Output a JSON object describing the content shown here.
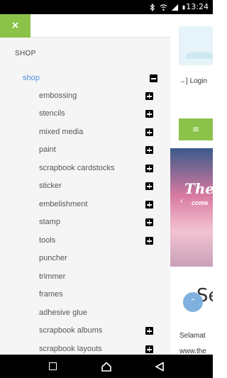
{
  "status_bar": {
    "time": "13:24",
    "icons": [
      "bluetooth-icon",
      "wifi-icon",
      "signal-icon",
      "battery-icon"
    ]
  },
  "drawer": {
    "close_symbol": "×",
    "section_title": "SHOP",
    "shop_label": "shop",
    "items": [
      {
        "label": "embossing",
        "expandable": true
      },
      {
        "label": "stencils",
        "expandable": true
      },
      {
        "label": "mixed media",
        "expandable": true
      },
      {
        "label": "paint",
        "expandable": true
      },
      {
        "label": "scrapbook cardstocks",
        "expandable": true
      },
      {
        "label": "sticker",
        "expandable": true
      },
      {
        "label": "embelishment",
        "expandable": true
      },
      {
        "label": "stamp",
        "expandable": true
      },
      {
        "label": "tools",
        "expandable": true
      },
      {
        "label": "puncher",
        "expandable": false
      },
      {
        "label": "trimmer",
        "expandable": false
      },
      {
        "label": "frames",
        "expandable": false
      },
      {
        "label": "adhesive glue",
        "expandable": false
      },
      {
        "label": "scrapbook albums",
        "expandable": true
      },
      {
        "label": "scrapbook layouts",
        "expandable": true
      }
    ]
  },
  "page": {
    "login_label": "Login",
    "menu_symbol": "≡",
    "promo_text_1": "The",
    "promo_text_2": "come",
    "heading_fragment": "Se",
    "paragraph_line_1": "Selamat",
    "paragraph_line_2": "www.the",
    "scroll_top_symbol": "⌃"
  },
  "colors": {
    "accent_green": "#8bc34a",
    "link_blue": "#4a90d9",
    "scroll_button": "#7fb0e0"
  }
}
